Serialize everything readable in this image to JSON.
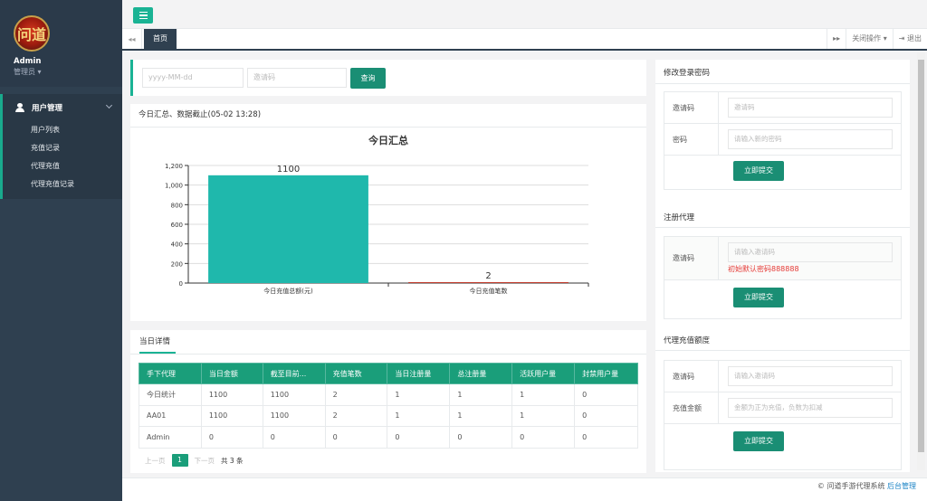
{
  "sidebar": {
    "logo_text": "问道",
    "user_name": "Admin",
    "user_role": "管理员 ▾",
    "group_label": "用户管理",
    "items": [
      {
        "label": "用户列表"
      },
      {
        "label": "充值记录"
      },
      {
        "label": "代理充值"
      },
      {
        "label": "代理充值记录"
      }
    ]
  },
  "tabs": {
    "prev": "◂◂",
    "home": "首页",
    "next": "▸▸",
    "close_ops": "关闭操作 ▾",
    "logout": "⇥ 退出"
  },
  "filter": {
    "date_placeholder": "yyyy-MM-dd",
    "code_placeholder": "邀请码",
    "query_label": "查询"
  },
  "summary": {
    "header": "今日汇总、数据截止(05-02 13:28)"
  },
  "chart_data": {
    "type": "bar",
    "title": "今日汇总",
    "categories": [
      "今日充值总额(元)",
      "今日充值笔数"
    ],
    "values": [
      1100,
      2
    ],
    "ylim": [
      0,
      1200
    ],
    "yticks": [
      "0",
      "200",
      "400",
      "600",
      "800",
      "1,000",
      "1,200"
    ],
    "colors": [
      "#1fb8ac",
      "#c0392b"
    ],
    "grid": true,
    "legend": false
  },
  "detail": {
    "tab_label": "当日详情",
    "columns": [
      "手下代理",
      "当日金额",
      "截至目前...",
      "充值笔数",
      "当日注册量",
      "总注册量",
      "活跃用户量",
      "封禁用户量"
    ],
    "rows": [
      [
        "今日统计",
        "1100",
        "1100",
        "2",
        "1",
        "1",
        "1",
        "0"
      ],
      [
        "AA01",
        "1100",
        "1100",
        "2",
        "1",
        "1",
        "1",
        "0"
      ],
      [
        "Admin",
        "0",
        "0",
        "0",
        "0",
        "0",
        "0",
        "0"
      ]
    ],
    "pager": {
      "prev": "上一页",
      "page": "1",
      "next": "下一页",
      "total": "共 3 条"
    }
  },
  "right": {
    "pwd": {
      "title": "修改登录密码",
      "code_label": "邀请码",
      "code_placeholder": "邀请码",
      "pwd_label": "密码",
      "pwd_placeholder": "请输入新的密码",
      "submit": "立即提交"
    },
    "agent": {
      "title": "注册代理",
      "code_label": "邀请码",
      "code_placeholder": "请输入邀请码",
      "hint": "初始默认密码888888",
      "submit": "立即提交"
    },
    "recharge": {
      "title": "代理充值额度",
      "code_label": "邀请码",
      "code_placeholder": "请输入邀请码",
      "amount_label": "充值金额",
      "amount_placeholder": "金额为正为充值，负数为扣减",
      "submit": "立即提交"
    }
  },
  "footer": {
    "copyright": "© 问道手游代理系统 ",
    "link": "后台管理"
  }
}
